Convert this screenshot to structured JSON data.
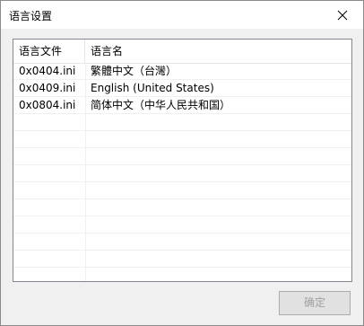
{
  "window": {
    "title": "语言设置"
  },
  "list": {
    "columns": [
      "语言文件",
      "语言名"
    ],
    "rows": [
      {
        "file": "0x0404.ini",
        "name": "繁體中文（台灣）"
      },
      {
        "file": "0x0409.ini",
        "name": "English (United States)"
      },
      {
        "file": "0x0804.ini",
        "name": "简体中文（中华人民共和国）"
      }
    ],
    "empty_rows": 10
  },
  "buttons": {
    "ok": "确定"
  },
  "icons": {
    "close": "close-icon"
  }
}
